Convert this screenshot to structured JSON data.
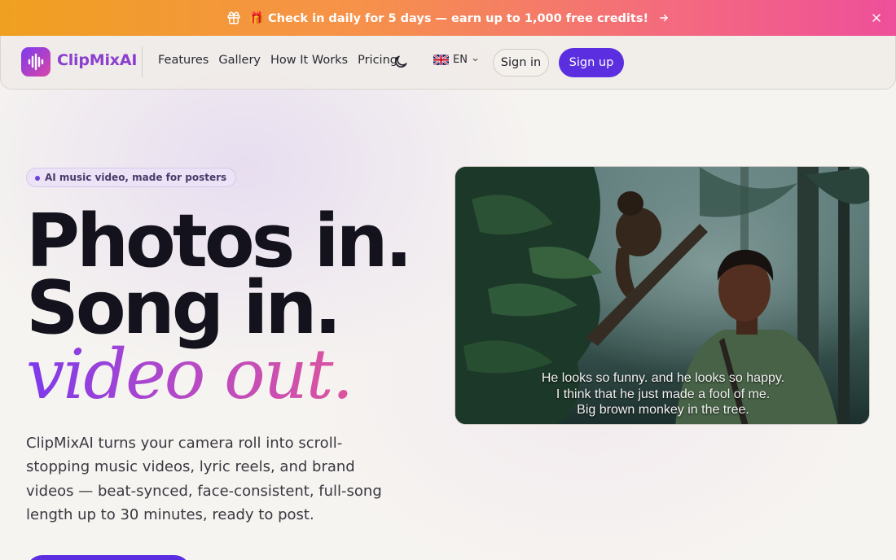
{
  "promo": {
    "text": "🎁 Check in daily for 5 days — earn up to 1,000 free credits!",
    "gift_icon": "gift-icon",
    "arrow_icon": "arrow-right-icon",
    "close_icon": "close-icon",
    "gradient": [
      "#f0a020",
      "#ee4f9a"
    ]
  },
  "nav": {
    "brand": "ClipMixAI",
    "logo_icon": "soundwave-icon",
    "links": [
      "Features",
      "Gallery",
      "How It Works",
      "Pricing"
    ],
    "theme_icon": "moon-icon",
    "language": "EN",
    "flag_icon": "uk-flag-icon",
    "signin_label": "Sign in",
    "signup_label": "Sign up",
    "accent": "#5b2ee0"
  },
  "hero": {
    "badge": "AI music video, made for posters",
    "headline_1": "Photos in.",
    "headline_2": "Song in.",
    "headline_3": "video out.",
    "lead": "ClipMixAI turns your camera roll into scroll-stopping music videos, lyric reels, and brand videos — beat-synced, face-consistent, full-song length up to 30 minutes, ready to post."
  },
  "video": {
    "subtitles": [
      "He looks so funny. and he looks so happy.",
      "I think that he just made a fool of me.",
      "Big brown monkey in the tree."
    ]
  }
}
